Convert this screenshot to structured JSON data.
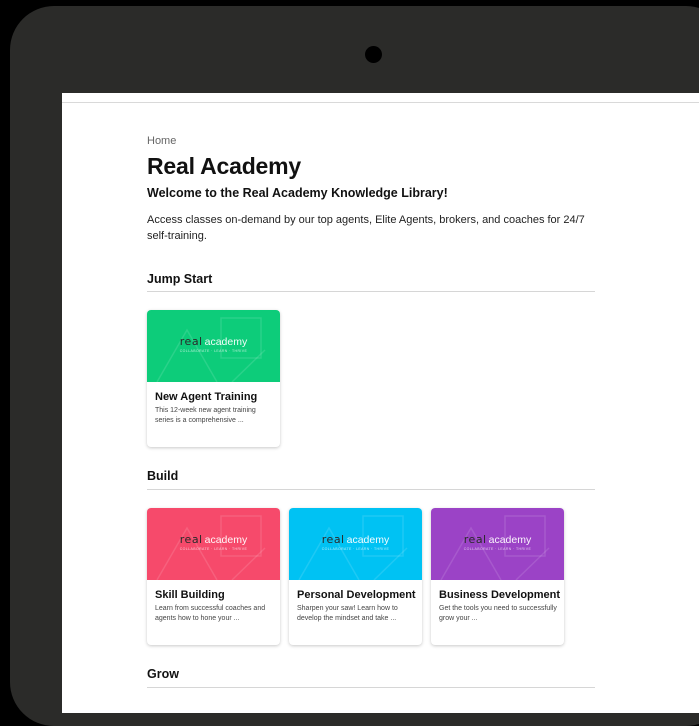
{
  "page": {
    "breadcrumb": "Home",
    "title": "Real Academy",
    "subtitle": "Welcome to the Real Academy Knowledge Library!",
    "description": "Access classes on-demand by our top agents, Elite Agents, brokers, and coaches for 24/7 self-training."
  },
  "thumbnail": {
    "brand": "real",
    "brand_suffix": "academy",
    "tagline": "COLLABORATE · LEARN · THRIVE"
  },
  "sections": [
    {
      "title": "Jump Start",
      "cards": [
        {
          "title": "New Agent Training",
          "description": "This 12-week new agent training series is a comprehensive ...",
          "color": "#0dcc7a"
        }
      ]
    },
    {
      "title": "Build",
      "cards": [
        {
          "title": "Skill Building",
          "description": "Learn from successful coaches and agents how to hone your ...",
          "color": "#f64a6b"
        },
        {
          "title": "Personal Development",
          "description": "Sharpen your saw! Learn how to develop the mindset and take ...",
          "color": "#00c2f3"
        },
        {
          "title": "Business Development",
          "description": "Get the tools you need to successfully grow your ...",
          "color": "#9b43c6"
        }
      ]
    },
    {
      "title": "Grow",
      "cards": []
    }
  ],
  "colors": {
    "device_frame": "#2b2b29",
    "background": "#000000"
  }
}
